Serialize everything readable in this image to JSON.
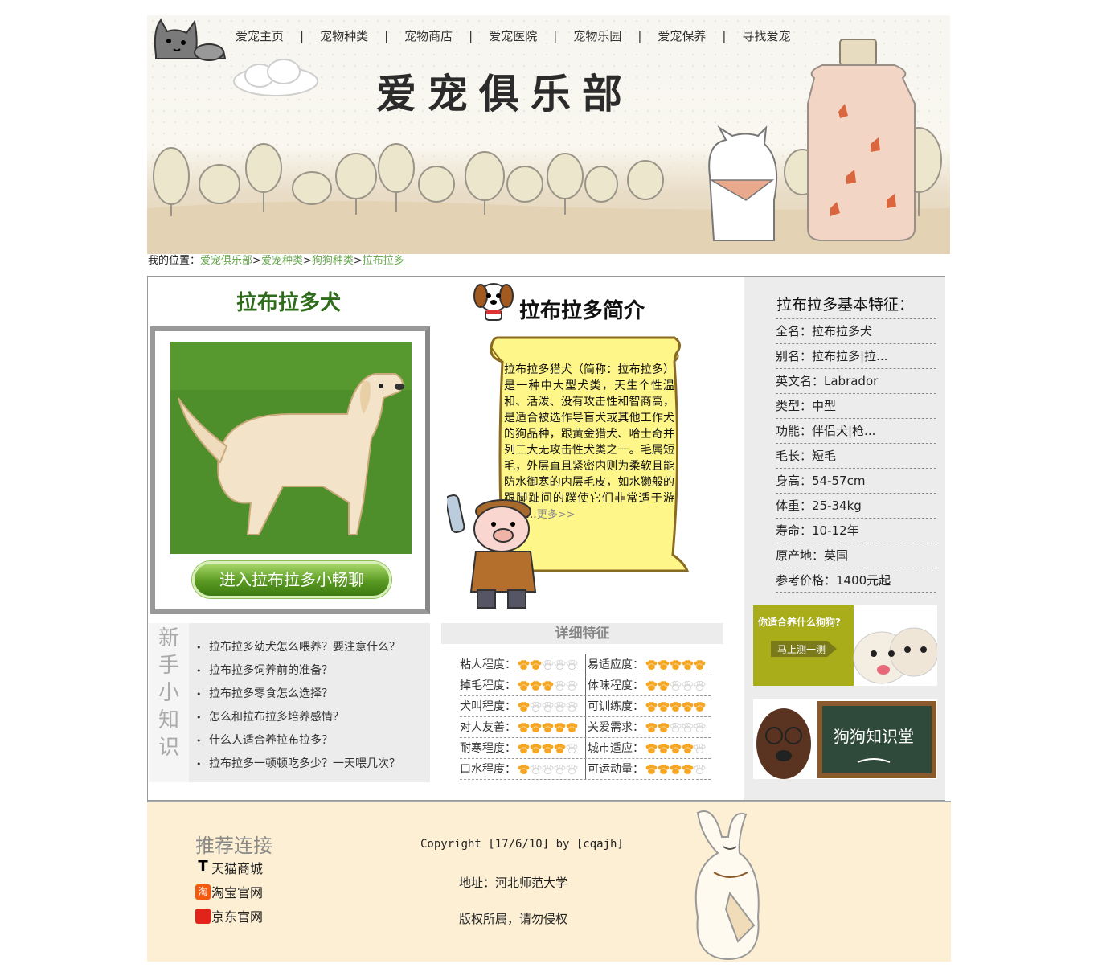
{
  "nav": [
    "爱宠主页",
    "宠物种类",
    "宠物商店",
    "爱宠医院",
    "宠物乐园",
    "爱宠保养",
    "寻找爱宠"
  ],
  "nav_separator": "|",
  "banner_title": "爱宠俱乐部",
  "breadcrumb": {
    "prefix": "我的位置：",
    "items": [
      "爱宠俱乐部",
      "爱宠种类",
      "狗狗种类",
      "拉布拉多"
    ],
    "sep": ">"
  },
  "dog_name": "拉布拉多犬",
  "enter_button": "进入拉布拉多小畅聊",
  "novice": {
    "title": "新手小知识",
    "items": [
      "拉布拉多幼犬怎么喂养？要注意什么？",
      "拉布拉多饲养前的准备？",
      "拉布拉多零食怎么选择？",
      "怎么和拉布拉多培养感情？",
      "什么人适合养拉布拉多？",
      "拉布拉多一顿顿吃多少？一天喂几次？"
    ]
  },
  "intro": {
    "title": "拉布拉多简介",
    "text": "拉布拉多猎犬（简称：拉布拉多）是一种中大型犬类，天生个性温和、活泼、没有攻击性和智商高，是适合被选作导盲犬或其他工作犬的狗品种，跟黄金猎犬、哈士奇并列三大无攻击性犬类之一。毛属短毛，外层直且紧密内则为柔软且能防水御寒的内层毛皮，如水獭般的跟脚趾间的蹼使它们非常适于游水......",
    "more": "更多>>"
  },
  "features": {
    "title": "详细特征",
    "rows": [
      [
        {
          "label": "粘人程度：",
          "value": 2
        },
        {
          "label": "易适应度：",
          "value": 5
        }
      ],
      [
        {
          "label": "掉毛程度：",
          "value": 3
        },
        {
          "label": "体味程度：",
          "value": 2
        }
      ],
      [
        {
          "label": "犬叫程度：",
          "value": 1
        },
        {
          "label": "可训练度：",
          "value": 5
        }
      ],
      [
        {
          "label": "对人友善：",
          "value": 5
        },
        {
          "label": "关爱需求：",
          "value": 2
        }
      ],
      [
        {
          "label": "耐寒程度：",
          "value": 4
        },
        {
          "label": "城市适应：",
          "value": 4
        }
      ],
      [
        {
          "label": "口水程度：",
          "value": 1
        },
        {
          "label": "可运动量：",
          "value": 4
        }
      ]
    ],
    "max": 5,
    "paw_color": "#f5a623",
    "paw_empty_color": "#e6e6e6"
  },
  "traits": {
    "title": "拉布拉多基本特征：",
    "items": [
      "全名：拉布拉多犬",
      "别名：拉布拉多|拉...",
      "英文名：Labrador",
      "类型：中型",
      "功能：伴侣犬|枪...",
      "毛长：短毛",
      "身高：54-57cm",
      "体重：25-34kg",
      "寿命：10-12年",
      "原产地：英国",
      "参考价格：1400元起"
    ]
  },
  "ad1": {
    "question": "你适合养什么狗狗?",
    "button": "马上测一测"
  },
  "ad2": {
    "title": "狗狗知识堂"
  },
  "footer": {
    "rec_title": "推荐连接",
    "links": [
      {
        "label": "天猫商城",
        "icon": "tmall-icon"
      },
      {
        "label": "淘宝官网",
        "icon": "taobao-icon",
        "icon_text": "淘"
      },
      {
        "label": "京东官网",
        "icon": "jd-icon"
      }
    ],
    "copyright": "Copyright [17/6/10] by [cqajh]",
    "address": "地址：河北师范大学",
    "rights": "版权所属，请勿侵权"
  }
}
